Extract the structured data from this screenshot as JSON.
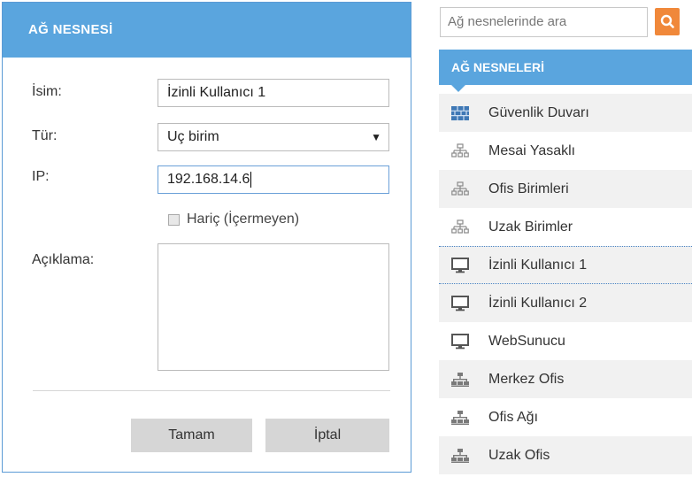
{
  "dialog": {
    "title": "AĞ NESNESİ",
    "fields": {
      "name_label": "İsim:",
      "name_value": "İzinli Kullanıcı 1",
      "type_label": "Tür:",
      "type_value": "Uç birim",
      "type_arrow": "▼",
      "ip_label": "IP:",
      "ip_value": "192.168.14.6",
      "exclude_label": "Hariç (İçermeyen)",
      "description_label": "Açıklama:"
    },
    "buttons": {
      "ok": "Tamam",
      "cancel": "İptal"
    }
  },
  "panel": {
    "search_placeholder": "Ağ nesnelerinde ara",
    "header": "AĞ NESNELERİ",
    "items": [
      {
        "label": "Güvenlik Duvarı",
        "icon": "firewall-icon"
      },
      {
        "label": "Mesai Yasaklı",
        "icon": "network-group-icon"
      },
      {
        "label": "Ofis Birimleri",
        "icon": "network-group-icon"
      },
      {
        "label": "Uzak Birimler",
        "icon": "network-group-icon"
      },
      {
        "label": "İzinli Kullanıcı 1",
        "icon": "monitor-icon"
      },
      {
        "label": "İzinli Kullanıcı 2",
        "icon": "monitor-icon"
      },
      {
        "label": "WebSunucu",
        "icon": "monitor-icon"
      },
      {
        "label": "Merkez Ofis",
        "icon": "network-icon"
      },
      {
        "label": "Ofis Ağı",
        "icon": "network-icon"
      },
      {
        "label": "Uzak Ofis",
        "icon": "network-icon"
      }
    ]
  },
  "colors": {
    "header_blue": "#5aa5de",
    "search_orange": "#f0883a",
    "button_gray": "#d6d6d6"
  }
}
